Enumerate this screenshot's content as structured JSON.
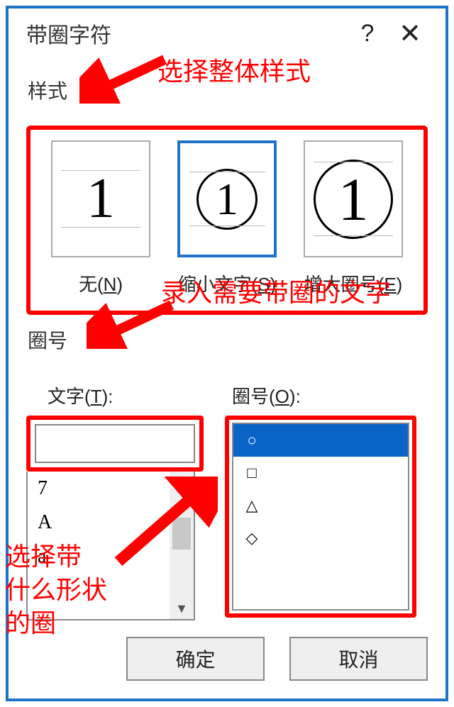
{
  "dialog": {
    "title": "带圈字符",
    "help_icon": "?",
    "close_icon": "✕"
  },
  "style": {
    "section_label": "样式",
    "options": [
      {
        "glyph": "1",
        "label_pre": "无(",
        "hotkey": "N",
        "label_post": ")"
      },
      {
        "glyph": "1",
        "label_pre": "缩小文字(",
        "hotkey": "S",
        "label_post": ")"
      },
      {
        "glyph": "1",
        "label_pre": "增大圈号(",
        "hotkey": "E",
        "label_post": ")"
      }
    ]
  },
  "enclosure": {
    "section_label": "圈号",
    "text_label_pre": "文字(",
    "text_hotkey": "T",
    "text_label_post": "):",
    "text_value": "",
    "suggestions": [
      "7",
      "A",
      "a"
    ],
    "enclosure_label_pre": "圈号(",
    "enclosure_hotkey": "O",
    "enclosure_label_post": "):",
    "shapes": [
      "○",
      "□",
      "△",
      "◇"
    ]
  },
  "buttons": {
    "ok": "确定",
    "cancel": "取消"
  },
  "annotations": {
    "a1": "选择整体样式",
    "a2": "录入需要带圈的文字",
    "a3": "选择带\n什么形状\n的圈"
  }
}
